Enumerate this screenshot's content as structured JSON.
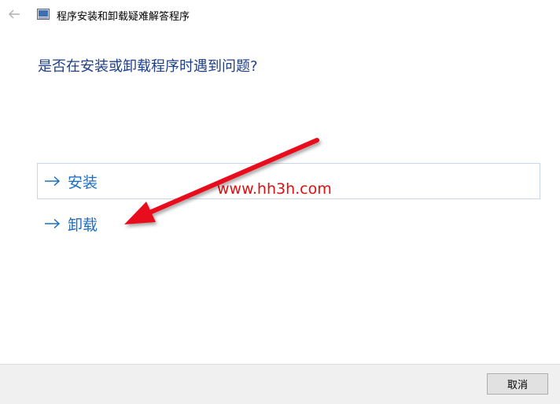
{
  "window": {
    "title": "程序安装和卸载疑难解答程序",
    "back_icon": "back-arrow-icon",
    "app_icon": "troubleshooter-app-icon"
  },
  "main": {
    "question": "是否在安装或卸载程序时遇到问题?",
    "options": [
      {
        "label": "安装",
        "icon": "right-arrow-icon"
      },
      {
        "label": "卸载",
        "icon": "right-arrow-icon"
      }
    ]
  },
  "watermark": {
    "text": "www.hh3h.com",
    "color": "#e01010"
  },
  "footer": {
    "cancel_label": "取消"
  },
  "colors": {
    "question_text": "#1e3f8a",
    "link_text": "#1d6ec1",
    "option_border": "#c6d7ea",
    "footer_bg": "#f0f0f0"
  }
}
